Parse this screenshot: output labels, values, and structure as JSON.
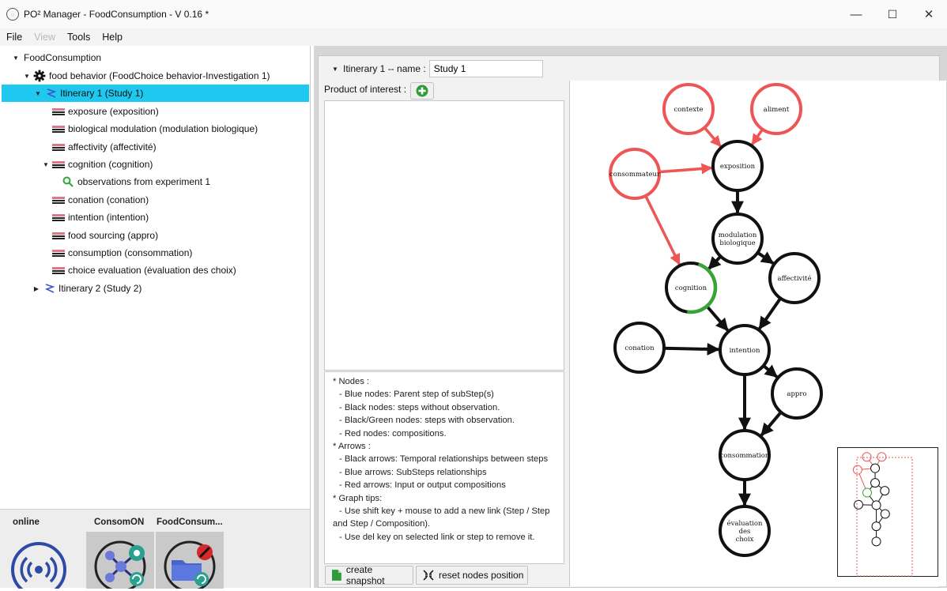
{
  "window": {
    "title": "PO² Manager - FoodConsumption - V 0.16 *",
    "minimize": "—",
    "maximize": "☐",
    "close": "✕"
  },
  "menu": [
    "File",
    "View",
    "Tools",
    "Help"
  ],
  "tree": {
    "root": "FoodConsumption",
    "project": "food behavior (FoodChoice behavior-Investigation 1)",
    "itinerary1": "Itinerary 1 (Study 1)",
    "steps": [
      "exposure (exposition)",
      "biological modulation (modulation biologique)",
      "affectivity (affectivité)",
      "cognition (cognition)",
      "observations from experiment 1",
      "conation (conation)",
      "intention (intention)",
      "food sourcing (appro)",
      "consumption (consommation)",
      "choice evaluation (évaluation des choix)"
    ],
    "itinerary2": "Itinerary 2 (Study 2)"
  },
  "repos": [
    {
      "label": "online"
    },
    {
      "label": "ConsomON"
    },
    {
      "label": "FoodConsum..."
    }
  ],
  "itinerary_header": {
    "label": "Itinerary 1  --  name :",
    "name_value": "Study 1"
  },
  "product_of_interest": {
    "label": "Product of interest :"
  },
  "help": [
    {
      "text": "* Nodes :",
      "cls": ""
    },
    {
      "text": "- Blue nodes: Parent step of subStep(s)",
      "cls": "sub"
    },
    {
      "text": "- Black nodes: steps without observation.",
      "cls": "sub"
    },
    {
      "text": "- Black/Green nodes: steps with observation.",
      "cls": "sub"
    },
    {
      "text": "- Red nodes: compositions.",
      "cls": "sub"
    },
    {
      "text": "* Arrows :",
      "cls": ""
    },
    {
      "text": "- Black arrows: Temporal relationships between steps",
      "cls": "sub"
    },
    {
      "text": "- Blue arrows: SubSteps relationships",
      "cls": "sub"
    },
    {
      "text": "- Red arrows: Input or output compositions",
      "cls": "sub"
    },
    {
      "text": "* Graph tips:",
      "cls": ""
    },
    {
      "text": "- Use shift key + mouse to add a new link (Step / Step",
      "cls": "sub"
    },
    {
      "text": "and Step / Composition).",
      "cls": "cont"
    },
    {
      "text": "- Use del key on selected link or step to remove it.",
      "cls": "sub"
    }
  ],
  "buttons": {
    "snapshot": "create snapshot",
    "reset": "reset nodes position"
  },
  "graph": {
    "colors": {
      "step": "#111111",
      "composition": "#ee5555",
      "observed": "#3aa335",
      "selection": "#1ec8ee"
    },
    "nodes": {
      "contexte": {
        "label": [
          "contexte"
        ],
        "kind": "composition"
      },
      "aliment": {
        "label": [
          "aliment"
        ],
        "kind": "composition"
      },
      "consommateur": {
        "label": [
          "consommateur"
        ],
        "kind": "composition"
      },
      "exposition": {
        "label": [
          "exposition"
        ],
        "kind": "step"
      },
      "modulation": {
        "label": [
          "modulation",
          "biologique"
        ],
        "kind": "step"
      },
      "cognition": {
        "label": [
          "cognition"
        ],
        "kind": "observed"
      },
      "affectivite": {
        "label": [
          "affectivité"
        ],
        "kind": "step"
      },
      "conation": {
        "label": [
          "conation"
        ],
        "kind": "step"
      },
      "intention": {
        "label": [
          "intention"
        ],
        "kind": "step"
      },
      "appro": {
        "label": [
          "appro"
        ],
        "kind": "step"
      },
      "consommation": {
        "label": [
          "consommation"
        ],
        "kind": "step"
      },
      "evaluation": {
        "label": [
          "évaluation",
          "des",
          "choix"
        ],
        "kind": "step"
      }
    },
    "edges": [
      [
        "contexte",
        "exposition",
        "composition"
      ],
      [
        "aliment",
        "exposition",
        "composition"
      ],
      [
        "consommateur",
        "exposition",
        "composition"
      ],
      [
        "consommateur",
        "cognition",
        "composition"
      ],
      [
        "exposition",
        "modulation",
        "step"
      ],
      [
        "modulation",
        "cognition",
        "step"
      ],
      [
        "modulation",
        "affectivite",
        "step"
      ],
      [
        "cognition",
        "intention",
        "step"
      ],
      [
        "affectivite",
        "intention",
        "step"
      ],
      [
        "conation",
        "intention",
        "step"
      ],
      [
        "intention",
        "appro",
        "step"
      ],
      [
        "intention",
        "consommation",
        "step"
      ],
      [
        "appro",
        "consommation",
        "step"
      ],
      [
        "consommation",
        "evaluation",
        "step"
      ]
    ]
  }
}
